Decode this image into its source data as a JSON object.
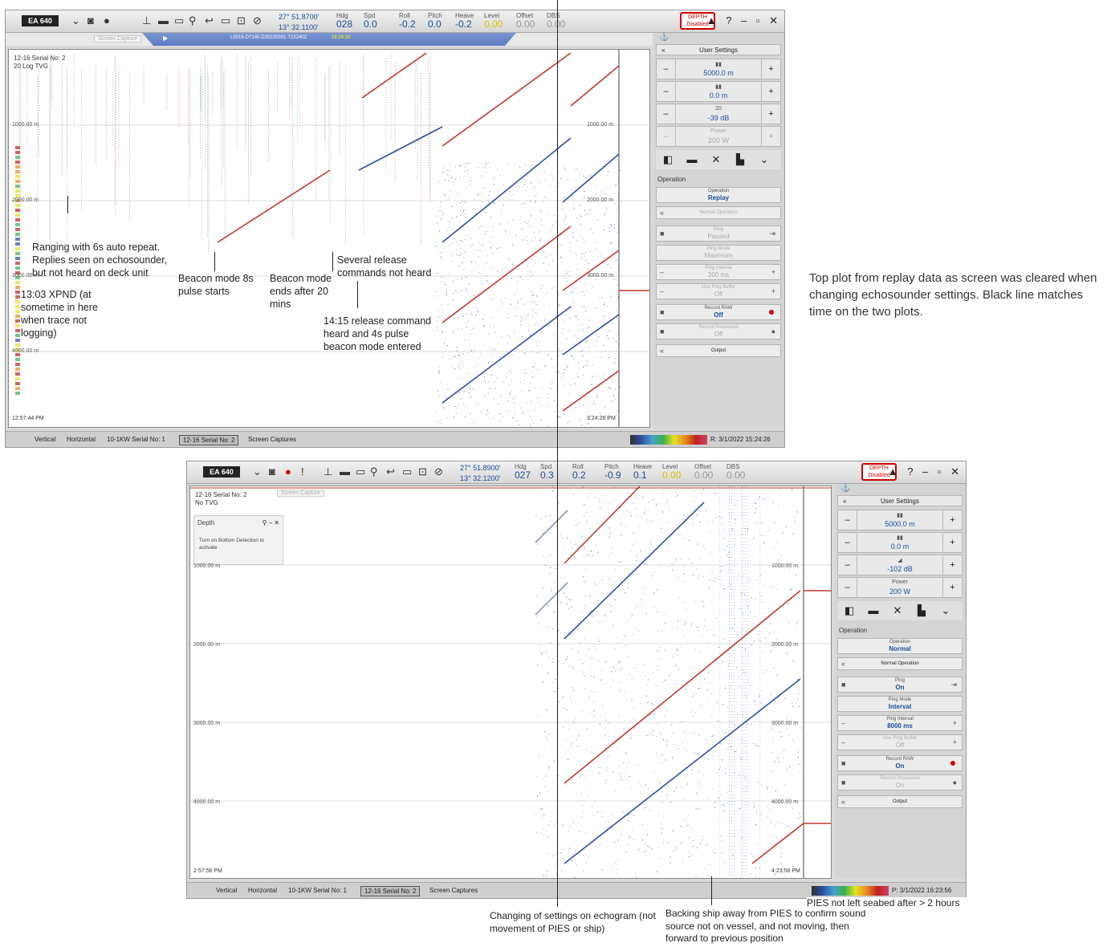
{
  "top": {
    "nav": {
      "lat": "27° 51.8700'",
      "lon": "13° 32.1100'",
      "hdg_label": "Hdg",
      "hdg": "028",
      "spd_label": "Spd",
      "spd": "0.0",
      "roll_label": "Roll",
      "roll": "-0.2",
      "pitch_label": "Pitch",
      "pitch": "0.0",
      "heave_label": "Heave",
      "heave": "-0.2",
      "level_label": "Level",
      "level": "0.00",
      "offset_label": "Offset",
      "offset": "0.00",
      "dbs_label": "DBS",
      "dbs": "0.00"
    },
    "depth_box": "DEPTH",
    "depth_state": "Disabled",
    "screen_capture": "Screen Capture",
    "replay_file": "L0016-D?140-D20220301-T152402",
    "replay_time": "15:24:26",
    "channel_label": "12-16 Serial No: 2",
    "tvg_label": "20 Log TVG",
    "depth_marks": [
      "1000.00 m",
      "2000.00 m",
      "3000.00 m",
      "4000.00 m"
    ],
    "start_time": "12:57:44 PM",
    "end_time": "3:24:26 PM",
    "panel": {
      "user_settings": "User Settings",
      "range": "5000.0 m",
      "start": "0.0 m",
      "gain": "-39 dB",
      "gain_top": "20",
      "power_label": "Power",
      "power": "200 W",
      "operation_section": "Operation",
      "operation_label": "Operation",
      "operation": "Replay",
      "normal_operation": "Normal Operation",
      "ping_label": "Ping",
      "ping": "Paused",
      "ping_mode_label": "Ping Mode",
      "ping_mode": "Maximum",
      "ping_interval_label": "Ping Interval",
      "ping_interval": "200 ms",
      "ping_buffer_label": "Use Ping Buffer",
      "ping_buffer": "Off",
      "record_raw_label": "Record RAW",
      "record_raw": "Off",
      "record_proc_label": "Record Processed",
      "record_proc": "Off",
      "output": "Output"
    },
    "tabs": [
      "Vertical",
      "Horizontal",
      "10-1KW Serial No: 1",
      "12-16 Serial No: 2",
      "Screen Captures"
    ],
    "status_time": "R: 3/1/2022  15:24:26"
  },
  "bottom": {
    "nav": {
      "lat": "27° 51.8900'",
      "lon": "13° 32.1200'",
      "hdg_label": "Hdg",
      "hdg": "027",
      "spd_label": "Spd",
      "spd": "0.3",
      "roll_label": "Roll",
      "roll": "0.2",
      "pitch_label": "Pitch",
      "pitch": "-0.9",
      "heave_label": "Heave",
      "heave": "0.1",
      "level_label": "Level",
      "level": "0.00",
      "offset_label": "Offset",
      "offset": "0.00",
      "dbs_label": "DBS",
      "dbs": "0.00"
    },
    "depth_box": "DEPTH",
    "depth_state": "Disabled",
    "screen_capture": "Screen Capture",
    "channel_label": "12-16 Serial No: 2",
    "tvg_label": "No TVG",
    "depth_window_title": "Depth",
    "depth_window_text": "Turn on Bottom Detection to activate",
    "depth_marks": [
      "1000.00 m",
      "2000.00 m",
      "3000.00 m",
      "4000.00 m"
    ],
    "start_time": "2:57:56 PM",
    "end_time": "4:23:56 PM",
    "panel": {
      "user_settings": "User Settings",
      "range": "5000.0 m",
      "start": "0.0 m",
      "gain": "-102 dB",
      "power_label": "Power",
      "power": "200 W",
      "operation_section": "Operation",
      "operation_label": "Operation",
      "operation": "Normal",
      "normal_operation": "Normal Operation",
      "ping_label": "Ping",
      "ping": "On",
      "ping_mode_label": "Ping Mode",
      "ping_mode": "Interval",
      "ping_interval_label": "Ping Interval",
      "ping_interval": "8000 ms",
      "ping_buffer_label": "Use Ping Buffer",
      "ping_buffer": "Off",
      "record_raw_label": "Record RAW",
      "record_raw": "On",
      "record_proc_label": "Record Processed",
      "record_proc": "On",
      "output": "Output"
    },
    "tabs": [
      "Vertical",
      "Horizontal",
      "10-1KW Serial No: 1",
      "12-16 Serial No: 2",
      "Screen Captures"
    ],
    "status_time": "P: 3/1/2022  16:23:56"
  },
  "annotations": {
    "ranging": "Ranging with 6s auto repeat. Replies seen on echosounder, but not heard on deck unit",
    "xpnd": "13:03 XPND (at sometime in here when trace not logging)",
    "beacon8": "Beacon mode 8s pulse starts",
    "beacon_end": "Beacon mode ends after 20 mins",
    "several": "Several release commands not heard",
    "release": "14:15 release command heard and 4s pulse beacon mode entered",
    "side_note": "Top plot from replay data as screen was cleared when changing echosounder settings. Black line matches time on the two plots.",
    "changing": "Changing of settings on echogram (not movement of PIES or ship)",
    "backing": "Backing ship away from PIES to confirm sound source not on vessel, and not moving, then forward to previous position",
    "pies": "PIES not left seabed after > 2 hours"
  }
}
